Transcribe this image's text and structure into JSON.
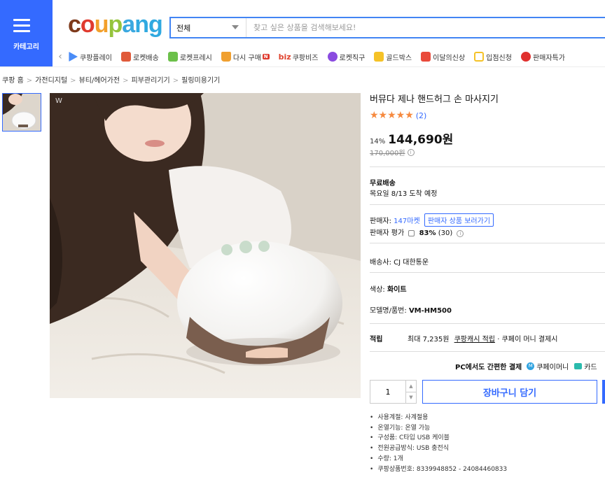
{
  "header": {
    "category_label": "카테고리",
    "logo_parts": [
      "c",
      "o",
      "u",
      "p",
      "a",
      "ng"
    ],
    "search_category": "전체",
    "search_placeholder": "찾고 싶은 상품을 검색해보세요!"
  },
  "subnav": {
    "items": [
      {
        "label": "쿠팡플레이",
        "icon": "play-icon",
        "color": "#4a8cf7"
      },
      {
        "label": "로켓배송",
        "icon": "rocket-icon",
        "color": "#e05a3a"
      },
      {
        "label": "로켓프레시",
        "icon": "rocket-fresh-icon",
        "color": "#6cc04a"
      },
      {
        "label": "다시 구매",
        "icon": "rebuy-icon",
        "color": "#f0a030",
        "badge": "N"
      },
      {
        "label": "쿠팡비즈",
        "icon": "biz-icon",
        "color": "#e0432e",
        "prefix": "biz"
      },
      {
        "label": "로켓직구",
        "icon": "global-icon",
        "color": "#8a4be0"
      },
      {
        "label": "골드박스",
        "icon": "gold-box-icon",
        "color": "#f5c227"
      },
      {
        "label": "이달의신상",
        "icon": "new-bag-icon",
        "color": "#e94a3b"
      },
      {
        "label": "입점신청",
        "icon": "store-icon",
        "color": "#3a8ee0"
      },
      {
        "label": "판매자특가",
        "icon": "percent-icon",
        "color": "#e0302e"
      }
    ]
  },
  "breadcrumb": [
    "쿠팡 홈",
    "가전디지털",
    "뷰티/헤어가전",
    "피부관리기기",
    "필링미용기기"
  ],
  "product": {
    "title": "버뮤다 제나 핸드허그 손 마사지기",
    "review_count": "(2)",
    "rating": 5,
    "discount": "14%",
    "price": "144,690원",
    "original_price": "170,000원",
    "shipping_label": "무료배송",
    "delivery_date": "목요일 8/13 도착 예정",
    "seller_label": "판매자:",
    "seller_name": "147마켓",
    "seller_button": "판매자 상품 보러가기",
    "seller_rating_label": "판매자 평가",
    "seller_rating": "83%",
    "seller_rating_count": "(30)",
    "carrier_label": "배송사:",
    "carrier": "CJ 대한통운",
    "color_label": "색상:",
    "color": "화이트",
    "model_label": "모델명/품번:",
    "model": "VM-HM500",
    "points_label": "적립",
    "points_text": "최대 7,235원",
    "points_link": "쿠팡캐시 적립",
    "points_note": "· 쿠페이 머니 결제시",
    "pc_pay": "PC에서도 간편한 결제",
    "coupay_money": "쿠페이머니",
    "card": "카드",
    "quantity": "1",
    "cart_button": "장바구니 담기",
    "details": [
      "사용계절: 사계절용",
      "온열기능: 온열 가능",
      "구성품: C타입 USB 케이블",
      "전원공급방식: USB 충전식",
      "수량: 1개",
      "쿠팡상품번호: 8339948852 - 24084460833"
    ]
  },
  "colors": {
    "accent": "#346aff",
    "star": "#f6893e"
  }
}
